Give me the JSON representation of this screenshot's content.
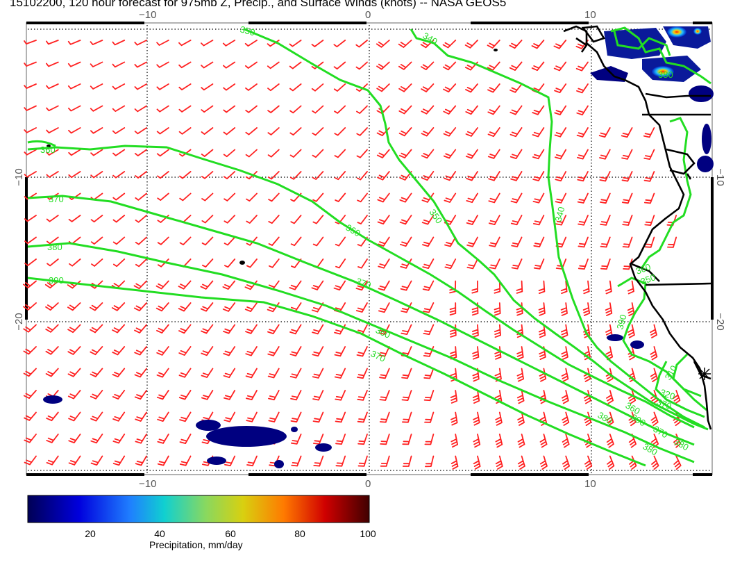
{
  "title": "15102200, 120 hour forecast for 975mb Z, Precip., and Surface Winds (knots) -- NASA GEOS5",
  "map": {
    "x_tick_labels": [
      "−10",
      "0",
      "10"
    ],
    "y_tick_labels": [
      "−10",
      "−20"
    ],
    "contour_labels": [
      "350",
      "340",
      "360",
      "370",
      "380",
      "390",
      "350",
      "360",
      "370",
      "360",
      "370",
      "380",
      "390",
      "380",
      "390",
      "370",
      "360",
      "380",
      "370",
      "380",
      "360",
      "340",
      "320",
      "310",
      "350"
    ],
    "colors": {
      "contour": "#22dd22",
      "wind_barb": "#ff2020",
      "coastline": "#000000",
      "precip_low": "#000080"
    }
  },
  "colorbar": {
    "ticks": [
      "20",
      "40",
      "60",
      "80",
      "100"
    ],
    "label": "Precipitation, mm/day",
    "range": [
      0,
      100
    ]
  }
}
